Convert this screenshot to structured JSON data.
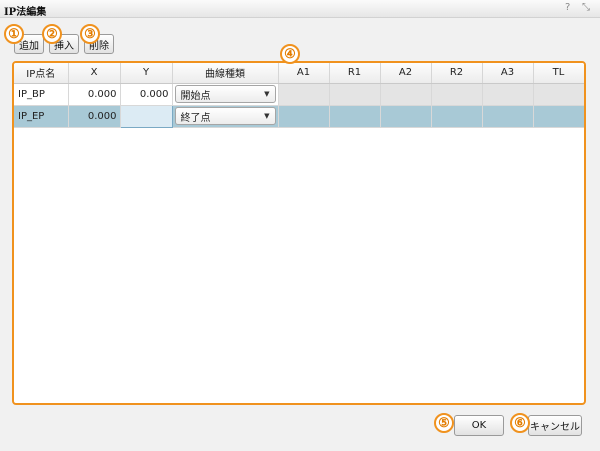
{
  "window": {
    "title": "IP法編集",
    "help_glyph": "?",
    "close_glyph": "⤡"
  },
  "toolbar": {
    "add_label": "追加",
    "insert_label": "挿入",
    "delete_label": "削除"
  },
  "markers": [
    "①",
    "②",
    "③",
    "④",
    "⑤",
    "⑥"
  ],
  "grid": {
    "columns": [
      "IP点名",
      "X",
      "Y",
      "曲線種類",
      "A1",
      "R1",
      "A2",
      "R2",
      "A3",
      "TL"
    ],
    "rows": [
      {
        "name": "IP_BP",
        "x": "0.000",
        "y": "0.000",
        "curve_type": "開始点"
      },
      {
        "name": "IP_EP",
        "x": "0.000",
        "y": "",
        "curve_type": "終了点"
      }
    ],
    "dropdown_arrow": "▼"
  },
  "footer": {
    "ok_label": "OK",
    "cancel_label": "キャンセル"
  }
}
